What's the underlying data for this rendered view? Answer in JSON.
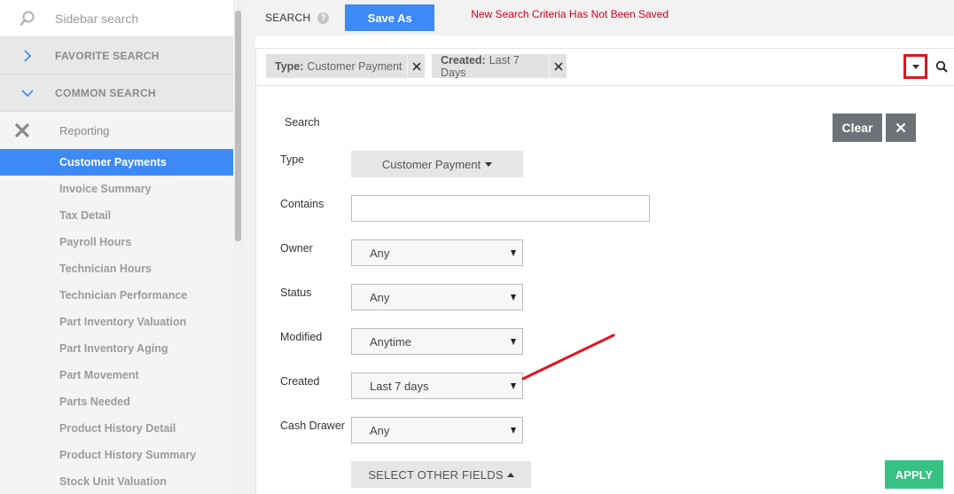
{
  "sidebar": {
    "search_placeholder": "Sidebar search",
    "favorite_label": "FAVORITE SEARCH",
    "common_label": "COMMON SEARCH",
    "reporting_label": "Reporting",
    "items": [
      {
        "label": "Customer Payments",
        "active": true
      },
      {
        "label": "Invoice Summary"
      },
      {
        "label": "Tax Detail"
      },
      {
        "label": "Payroll Hours"
      },
      {
        "label": "Technician Hours"
      },
      {
        "label": "Technician Performance"
      },
      {
        "label": "Part Inventory Valuation"
      },
      {
        "label": "Part Inventory Aging"
      },
      {
        "label": "Part Movement"
      },
      {
        "label": "Parts Needed"
      },
      {
        "label": "Product History Detail"
      },
      {
        "label": "Product History Summary"
      },
      {
        "label": "Stock Unit Valuation"
      }
    ]
  },
  "topbar": {
    "title": "SEARCH",
    "help": "?",
    "save_as_label": "Save As",
    "unsaved_message": "New Search Criteria Has Not Been Saved"
  },
  "filters": {
    "chips": [
      {
        "key": "Type:",
        "value": "Customer Payment"
      },
      {
        "key": "Created:",
        "value": "Last 7 Days"
      }
    ]
  },
  "form": {
    "title": "Search",
    "clear_label": "Clear",
    "type": {
      "label": "Type",
      "value": "Customer Payment"
    },
    "contains": {
      "label": "Contains",
      "value": ""
    },
    "owner": {
      "label": "Owner",
      "value": "Any"
    },
    "status": {
      "label": "Status",
      "value": "Any"
    },
    "modified": {
      "label": "Modified",
      "value": "Anytime"
    },
    "created": {
      "label": "Created",
      "value": "Last 7 days"
    },
    "cash_drawer": {
      "label": "Cash Drawer",
      "value": "Any"
    },
    "other_fields_label": "SELECT OTHER FIELDS",
    "apply_label": "APPLY"
  },
  "colors": {
    "accent": "#3d8af7",
    "apply": "#35c284",
    "alert": "#d0021b",
    "annotation": "#e0141e"
  }
}
